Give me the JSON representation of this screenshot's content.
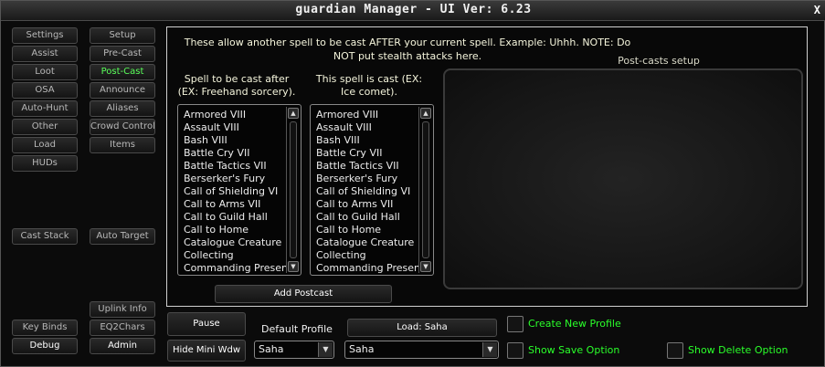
{
  "window": {
    "title": "guardian Manager  - UI Ver: 6.23",
    "close_label": "X"
  },
  "nav_left": [
    "Settings",
    "Assist",
    "Loot",
    "OSA",
    "Auto-Hunt",
    "Other",
    "Load",
    "HUDs"
  ],
  "nav_right": [
    "Setup",
    "Pre-Cast",
    "Post-Cast",
    "Announce",
    "Aliases",
    "Crowd Control",
    "Items"
  ],
  "active_nav": "Post-Cast",
  "cast_stack_label": "Cast Stack",
  "auto_target_label": "Auto Target",
  "uplink_info_label": "Uplink Info",
  "key_binds_label": "Key Binds",
  "eq2chars_label": "EQ2Chars",
  "debug_label": "Debug",
  "admin_label": "Admin",
  "main": {
    "hint": "These allow another spell to be cast AFTER your current spell. Example: Uhhh. NOTE: Do NOT put stealth attacks here.",
    "col1_label": "Spell to be cast after (EX: Freehand sorcery).",
    "col2_label": "This spell is cast (EX: Ice comet).",
    "spells": [
      "Armored VIII",
      "Assault VIII",
      "Bash VIII",
      "Battle Cry VII",
      "Battle Tactics VII",
      "Berserker's Fury",
      "Call of Shielding VI",
      "Call to Arms VII",
      "Call to Guild Hall",
      "Call to Home",
      "Catalogue Creature",
      "Collecting",
      "Commanding Presence"
    ],
    "add_button": "Add Postcast",
    "setup_title": "Post-casts setup"
  },
  "bottom": {
    "pause_label": "Pause",
    "hide_mini_label": "Hide Mini Wdw",
    "default_profile_label": "Default Profile",
    "load_label": "Load: Saha",
    "profile_value": "Saha",
    "load_value": "Saha",
    "create_profile_label": "Create New Profile",
    "show_save_label": "Show Save Option",
    "show_delete_label": "Show Delete Option"
  }
}
